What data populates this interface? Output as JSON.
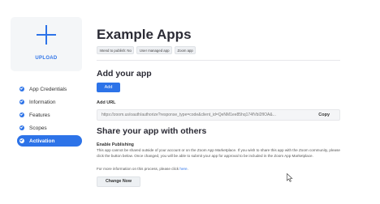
{
  "upload": {
    "label": "UPLOAD",
    "icon": "plus-icon"
  },
  "sidebar": {
    "items": [
      {
        "label": "App Credentials",
        "icon": "check-circle-icon",
        "active": false
      },
      {
        "label": "Information",
        "icon": "check-circle-icon",
        "active": false
      },
      {
        "label": "Features",
        "icon": "check-circle-icon",
        "active": false
      },
      {
        "label": "Scopes",
        "icon": "check-circle-icon",
        "active": false
      },
      {
        "label": "Activation",
        "icon": "check-circle-icon",
        "active": true
      }
    ]
  },
  "header": {
    "title": "Example Apps",
    "tags": [
      "Intend to publish: No",
      "User managed app",
      "Zoom app"
    ]
  },
  "add_app": {
    "heading": "Add your app",
    "add_button": "Add",
    "url_label": "Add URL",
    "url_value": "https://zoom.us/oauth/authorize?response_type=code&client_id=QeNM1ee85hq174fVbl2fIOA&...",
    "copy_button": "Copy"
  },
  "share": {
    "heading": "Share your app with others",
    "enable_label": "Enable Publishing",
    "description": "This app cannot be shared outside of your account or on the Zoom App Marketplace. If you wish to share this app with the Zoom community, please click the button below. Once changed, you will be able to submit your app for approval to be included in the Zoom App Marketplace.",
    "more_info_prefix": "For more information on this process, please click",
    "more_info_link": "here",
    "more_info_suffix": ".",
    "change_button": "Change Now"
  },
  "colors": {
    "accent": "#2d73e8",
    "title": "#2b2b35"
  }
}
